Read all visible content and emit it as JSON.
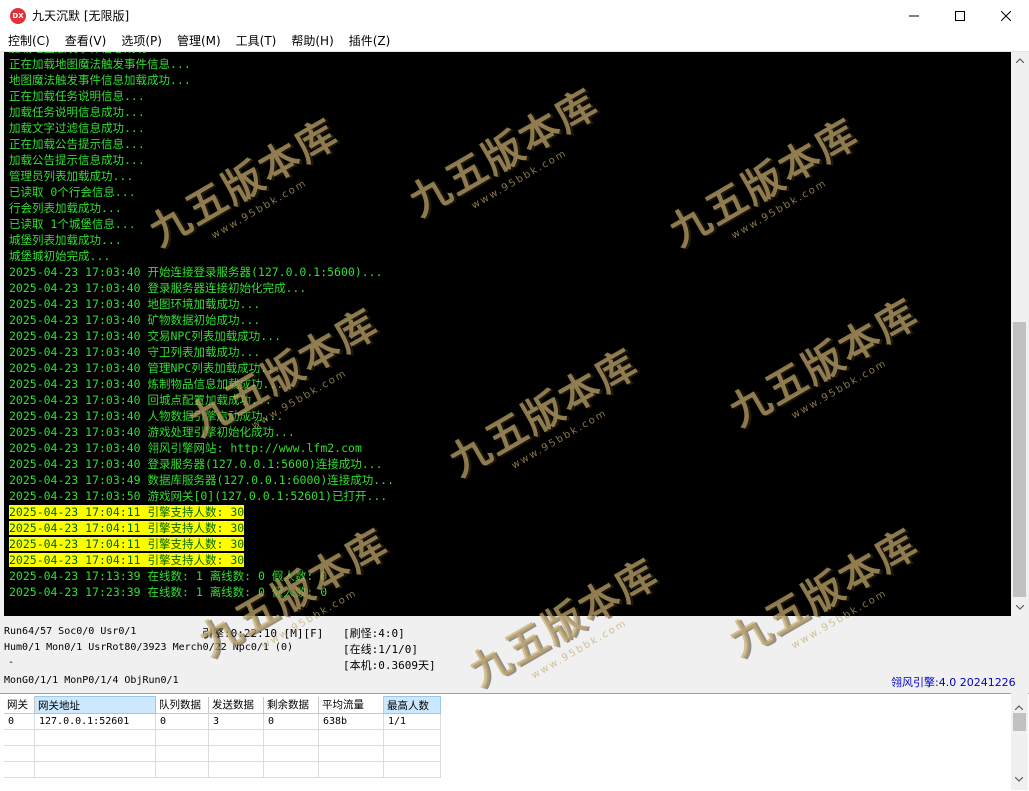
{
  "window": {
    "icon_text": "DX",
    "title": "九天沉默 [无限版]"
  },
  "menu": [
    "控制(C)",
    "查看(V)",
    "选项(P)",
    "管理(M)",
    "工具(T)",
    "帮助(H)",
    "插件(Z)"
  ],
  "log": [
    {
      "text": "加载地图触发事件信息成功...",
      "hl": false
    },
    {
      "text": "正在加载地图魔法触发事件信息...",
      "hl": false
    },
    {
      "text": "地图魔法触发事件信息加载成功...",
      "hl": false
    },
    {
      "text": "正在加载任务说明信息...",
      "hl": false
    },
    {
      "text": "加载任务说明信息成功...",
      "hl": false
    },
    {
      "text": "加载文字过滤信息成功...",
      "hl": false
    },
    {
      "text": "正在加载公告提示信息...",
      "hl": false
    },
    {
      "text": "加载公告提示信息成功...",
      "hl": false
    },
    {
      "text": "管理员列表加载成功...",
      "hl": false
    },
    {
      "text": "已读取 0个行会信息...",
      "hl": false
    },
    {
      "text": "行会列表加载成功...",
      "hl": false
    },
    {
      "text": "已读取 1个城堡信息...",
      "hl": false
    },
    {
      "text": "城堡列表加载成功...",
      "hl": false
    },
    {
      "text": "城堡城初始完成...",
      "hl": false
    },
    {
      "text": "2025-04-23 17:03:40 开始连接登录服务器(127.0.0.1:5600)...",
      "hl": false
    },
    {
      "text": "2025-04-23 17:03:40 登录服务器连接初始化完成...",
      "hl": false
    },
    {
      "text": "2025-04-23 17:03:40 地图环境加载成功...",
      "hl": false
    },
    {
      "text": "2025-04-23 17:03:40 矿物数据初始成功...",
      "hl": false
    },
    {
      "text": "2025-04-23 17:03:40 交易NPC列表加载成功...",
      "hl": false
    },
    {
      "text": "2025-04-23 17:03:40 守卫列表加载成功...",
      "hl": false
    },
    {
      "text": "2025-04-23 17:03:40 管理NPC列表加载成功...",
      "hl": false
    },
    {
      "text": "2025-04-23 17:03:40 炼制物品信息加载成功...",
      "hl": false
    },
    {
      "text": "2025-04-23 17:03:40 回城点配置加载成功...",
      "hl": false
    },
    {
      "text": "2025-04-23 17:03:40 人物数据引擎启动成功...",
      "hl": false
    },
    {
      "text": "2025-04-23 17:03:40 游戏处理引擎初始化成功...",
      "hl": false
    },
    {
      "text": "2025-04-23 17:03:40 翎风引擎网站: http://www.lfm2.com",
      "hl": false
    },
    {
      "text": "2025-04-23 17:03:40 登录服务器(127.0.0.1:5600)连接成功...",
      "hl": false
    },
    {
      "text": "2025-04-23 17:03:49 数据库服务器(127.0.0.1:6000)连接成功...",
      "hl": false
    },
    {
      "text": "2025-04-23 17:03:50 游戏网关[0](127.0.0.1:52601)已打开...",
      "hl": false
    },
    {
      "text": "2025-04-23 17:04:11 引擎支持人数: 30",
      "hl": true
    },
    {
      "text": "2025-04-23 17:04:11 引擎支持人数: 30",
      "hl": true
    },
    {
      "text": "2025-04-23 17:04:11 引擎支持人数: 30",
      "hl": true
    },
    {
      "text": "2025-04-23 17:04:11 引擎支持人数: 30",
      "hl": true
    },
    {
      "text": "2025-04-23 17:13:39 在线数: 1 离线数: 0 假人数: 0",
      "hl": false
    },
    {
      "text": "2025-04-23 17:23:39 在线数: 1 离线数: 0 假人数: 0",
      "hl": false
    }
  ],
  "status": {
    "line1": "Run64/57 Soc0/0 Usr0/1",
    "engine_time": "引擎:0:22:10 [M][F]",
    "refresh": "[刷怪:4:0]",
    "line2": "Hum0/1 Mon0/1 UsrRot80/3923 Merch0/22 Npc0/1 (0)",
    "online": "[在线:1/1/0]",
    "dash": "-",
    "local": "[本机:0.3609天]",
    "line4": "MonG0/1/1 MonP0/1/4 ObjRun0/1",
    "engine_version": "翎风引擎:4.0 20241226"
  },
  "gate_table": {
    "columns": [
      "网关",
      "网关地址",
      "队列数据",
      "发送数据",
      "剩余数据",
      "平均流量",
      "最高人数"
    ],
    "rows": [
      [
        "0",
        "127.0.0.1:52601",
        "0",
        "3",
        "0",
        "638b",
        "1/1"
      ]
    ]
  },
  "watermark": {
    "main": "九五版本库",
    "sub": "www.95bbk.com"
  }
}
